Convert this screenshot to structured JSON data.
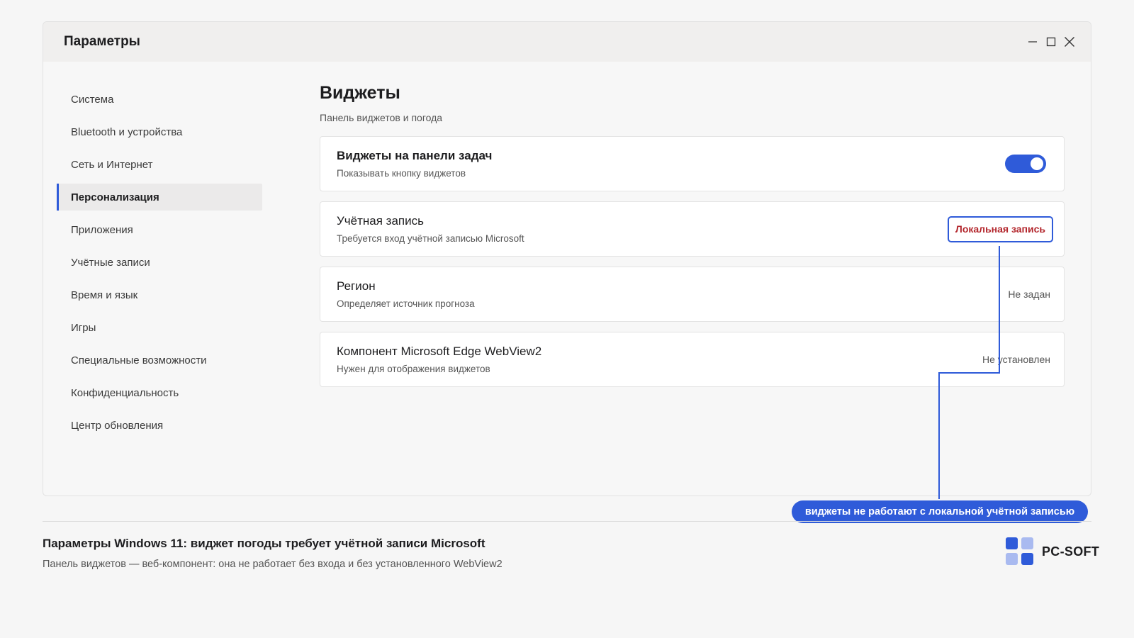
{
  "window": {
    "title": "Параметры",
    "controls": [
      "minimize-icon",
      "maximize-icon",
      "close-icon"
    ]
  },
  "sidebar": {
    "items": [
      {
        "label": "Система",
        "active": false
      },
      {
        "label": "Bluetooth и устройства",
        "active": false
      },
      {
        "label": "Сеть и Интернет",
        "active": false
      },
      {
        "label": "Персонализация",
        "active": true
      },
      {
        "label": "Приложения",
        "active": false
      },
      {
        "label": "Учётные записи",
        "active": false
      },
      {
        "label": "Время и язык",
        "active": false
      },
      {
        "label": "Игры",
        "active": false
      },
      {
        "label": "Специальные возможности",
        "active": false
      },
      {
        "label": "Конфиденциальность",
        "active": false
      },
      {
        "label": "Центр обновления",
        "active": false
      }
    ]
  },
  "main": {
    "title": "Виджеты",
    "subtitle": "Панель виджетов и погода",
    "cards": [
      {
        "title": "Виджеты на панели задач",
        "desc": "Показывать кнопку виджетов",
        "toggle_on": true
      },
      {
        "title": "Учётная запись",
        "desc": "Требуется вход учётной записью Microsoft",
        "value": "Локальная запись"
      },
      {
        "title": "Регион",
        "desc": "Определяет источник прогноза",
        "value": "Не задан"
      },
      {
        "title": "Компонент Microsoft Edge WebView2",
        "desc": "Нужен для отображения виджетов",
        "value": "Не установлен"
      }
    ]
  },
  "callout": {
    "text": "виджеты не работают с локальной учётной записью"
  },
  "caption": {
    "title": "Параметры Windows 11: виджет погоды требует учётной записи Microsoft",
    "subtitle": "Панель виджетов — веб-компонент: она не работает без входа и без установленного WebView2"
  },
  "brand": {
    "name": "PC-SOFT"
  },
  "colors": {
    "accent": "#2f5bd9",
    "warning_text": "#b3262c",
    "logo_dark": "#2f5bd9",
    "logo_light": "#a9baf0"
  }
}
